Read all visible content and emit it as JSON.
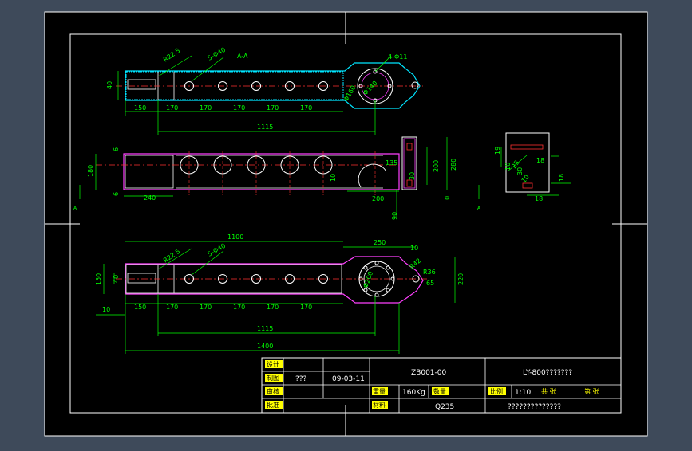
{
  "colors": {
    "background": "#3e4a5a",
    "sheet": "#000000",
    "border": "#ffffff",
    "dimension": "#00ff00",
    "part_outline": "#ffffff",
    "hidden": "#ff3030",
    "hatch": "#00e5ff",
    "section": "#ff40ff",
    "cyan_box": "#00e5ff",
    "title_fill": "#ffff00",
    "title_text": "#ffffff"
  },
  "dims": {
    "top": {
      "r225": "R22.5",
      "holes5": "5-Φ40",
      "section_mark": "A-A",
      "holes4": "4-Φ11",
      "d160": "Φ160",
      "d140": "Φ140",
      "h40": "40",
      "s150": "150",
      "s170": "170",
      "total1115": "1115"
    },
    "middle": {
      "d6a": "6",
      "d180": "180",
      "d6b": "6",
      "d240": "240",
      "d10": "10",
      "d135": "135",
      "d200": "200",
      "d90": "90",
      "side200": "200",
      "side280": "280",
      "side30": "30",
      "side10": "10",
      "markA": "A"
    },
    "right": {
      "d10": "10",
      "d30": "30",
      "d18a": "18",
      "d18b": "18",
      "d19": "19",
      "d25": "25",
      "r10": "10",
      "markA": "A"
    },
    "bottom": {
      "d1100": "1100",
      "d250": "250",
      "d10a": "10",
      "r225": "R22.5",
      "holes5": "5-Φ40",
      "d150": "150",
      "d40": "40",
      "d10b": "10",
      "d170": "170",
      "s150": "150",
      "d1115": "1115",
      "d1400": "1400",
      "d200": "Φ200",
      "r42": "R42",
      "r36": "R36",
      "d65": "65",
      "d220": "220"
    }
  },
  "title_block": {
    "label_design": "设计",
    "label_draw": "制图",
    "label_check": "审核",
    "label_approve": "批准",
    "drafter": "???",
    "date": "09-03-11",
    "drawing_no": "ZB001-00",
    "title": "LY-800???????",
    "label_weight": "重量",
    "weight": "160Kg",
    "label_qty": "数量",
    "label_scale": "比例",
    "scale": "1:10",
    "label_sheets_total": "共 张",
    "label_sheet_no": "第 张",
    "label_material": "材料",
    "material": "Q235",
    "company": "??????????????"
  }
}
